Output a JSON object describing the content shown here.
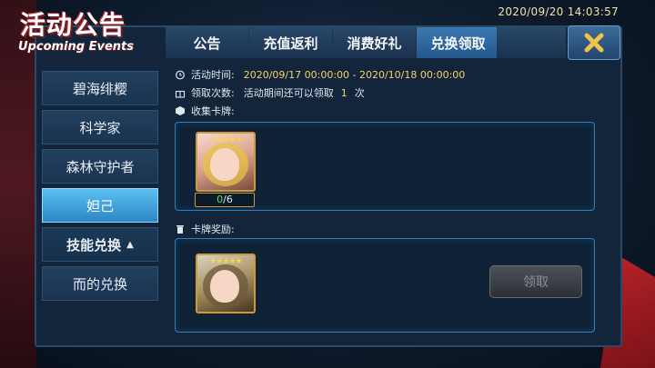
{
  "datetime": "2020/09/20  14:03:57",
  "logo": {
    "cn": "活动公告",
    "en": "Upcoming Events"
  },
  "tabs": [
    "公告",
    "充值返利",
    "消费好礼",
    "兑换领取"
  ],
  "active_tab": 3,
  "sidebar": {
    "items": [
      {
        "label": "碧海绯樱"
      },
      {
        "label": "科学家"
      },
      {
        "label": "森林守护者"
      },
      {
        "label": "妲己"
      },
      {
        "label": "技能兑换",
        "caret": "▲"
      },
      {
        "label": "而的兑换"
      }
    ],
    "active_index": 3
  },
  "event": {
    "time_label": "活动时间:",
    "time_value": "2020/09/17 00:00:00 - 2020/10/18 00:00:00",
    "claim_label": "领取次数:",
    "claim_text": "活动期间还可以领取",
    "claim_count": "1",
    "claim_unit": "次",
    "collect_label": "收集卡牌:",
    "reward_label": "卡牌奖励:"
  },
  "collect_card": {
    "stars": "★★★★★",
    "progress_current": "0",
    "progress_sep": "/",
    "progress_total": "6"
  },
  "reward_card": {
    "stars": "★★★★★"
  },
  "claim_button": "领取",
  "colors": {
    "accent": "#3b79b2",
    "highlight": "#f2d36b",
    "progress_green": "#57e05b"
  }
}
